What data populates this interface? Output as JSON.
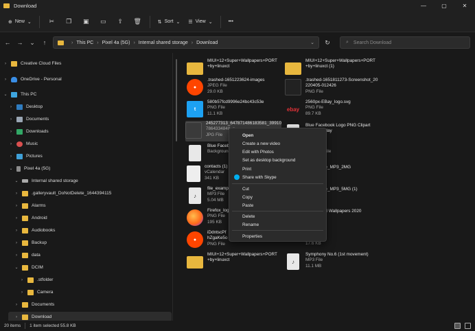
{
  "window": {
    "title": "Download",
    "controls": [
      "—",
      "▢",
      "✕"
    ]
  },
  "commandbar": {
    "new_label": "New",
    "sort_label": "Sort",
    "view_label": "View",
    "more_label": "•••"
  },
  "address": {
    "crumbs": [
      "This PC",
      "Pixel 4a (5G)",
      "Internal shared storage",
      "Download"
    ],
    "search_placeholder": "Search Download"
  },
  "nav": {
    "items": [
      {
        "label": "Creative Cloud Files"
      },
      {
        "label": "OneDrive - Personal"
      },
      {
        "label": "This PC"
      },
      {
        "label": "Desktop"
      },
      {
        "label": "Documents"
      },
      {
        "label": "Downloads"
      },
      {
        "label": "Music"
      },
      {
        "label": "Pictures"
      },
      {
        "label": "Pixel 4a (5G)"
      },
      {
        "label": "Internal shared storage"
      },
      {
        "label": ".galleryvault_DoNotDelete_1644394115"
      },
      {
        "label": "Alarms"
      },
      {
        "label": "Android"
      },
      {
        "label": "Audiobooks"
      },
      {
        "label": "Backup"
      },
      {
        "label": "data"
      },
      {
        "label": "DCIM"
      },
      {
        "label": ".stfolder"
      },
      {
        "label": "Camera"
      },
      {
        "label": "Documents"
      },
      {
        "label": "Download"
      }
    ]
  },
  "files": [
    {
      "name": "MIUI+12+Super+Wallpapers+PORT",
      "line2": "+by+linuxct",
      "line3": ""
    },
    {
      "name": "MIUI+12+Super+Wallpapers+PORT",
      "line2": "+by+linuxct (1)",
      "line3": ""
    },
    {
      "name": ".trashed-1651223624-images",
      "line2": "JPEG File",
      "line3": "29.0 KB"
    },
    {
      "name": ".trashed-1651811273-Screenshot_20",
      "line2": "220405-012426",
      "line3": "PNG File"
    },
    {
      "name": "580b57fcd9996e24bc43c53e",
      "line2": "PNG File",
      "line3": "11.1 KB"
    },
    {
      "name": "2560px-EBay_logo.svg",
      "line2": "PNG File",
      "line3": "89.7 KB"
    },
    {
      "name": "245277313_647871486183581_39910",
      "line2": "7864334848_n",
      "line3": "JPG File"
    },
    {
      "name": "Blue Facebook Logo PNG Clipart",
      "line2": "d _ PNG Play",
      "line3": ""
    },
    {
      "name": "Blue Facebook",
      "line2": "Background",
      "line3": ""
    },
    {
      "name": "File",
      "line2": "",
      "line3": ""
    },
    {
      "name": "contacts (1)",
      "line2": "vCalendar",
      "line3": "341 KB"
    },
    {
      "name": "le_MP3_2MG",
      "line2": "",
      "line3": ""
    },
    {
      "name": "file_example",
      "line2": "MP3 File",
      "line3": "5.04 MB"
    },
    {
      "name": "le_MP3_5MG (1)",
      "line2": "",
      "line3": ""
    },
    {
      "name": "Firefox_logo",
      "line2": "PNG File",
      "line3": "195 KB"
    },
    {
      "name": "el Wallpapers 2020",
      "line2": "",
      "line3": ""
    },
    {
      "name": "iDdntscPf",
      "line2": "hZgaKe5o",
      "line3": "PNG File"
    },
    {
      "name": "17.6 KB",
      "line2": "",
      "line3": ""
    },
    {
      "name": "MIUI+12+Super+Wallpapers+PORT",
      "line2": "+by+linuxct",
      "line3": ""
    },
    {
      "name": "Symphony No.6 (1st movement)",
      "line2": "MP3 File",
      "line3": "11.1 MB"
    }
  ],
  "thumb_text": {
    "ebay": "ebay",
    "twitter": "t",
    "mp3": "♪",
    "reddit": "●"
  },
  "context_menu": {
    "open": "Open",
    "create_video": "Create a new video",
    "edit_photos": "Edit with Photos",
    "set_background": "Set as desktop background",
    "print": "Print",
    "share_skype": "Share with Skype",
    "cut": "Cut",
    "copy": "Copy",
    "paste": "Paste",
    "delete": "Delete",
    "rename": "Rename",
    "properties": "Properties"
  },
  "status": {
    "items": "20 items",
    "selected": "1 item selected  55.8 KB"
  },
  "colors": {
    "accent": "#e8b73e",
    "background": "#191919",
    "menu": "#2b2b2b"
  }
}
